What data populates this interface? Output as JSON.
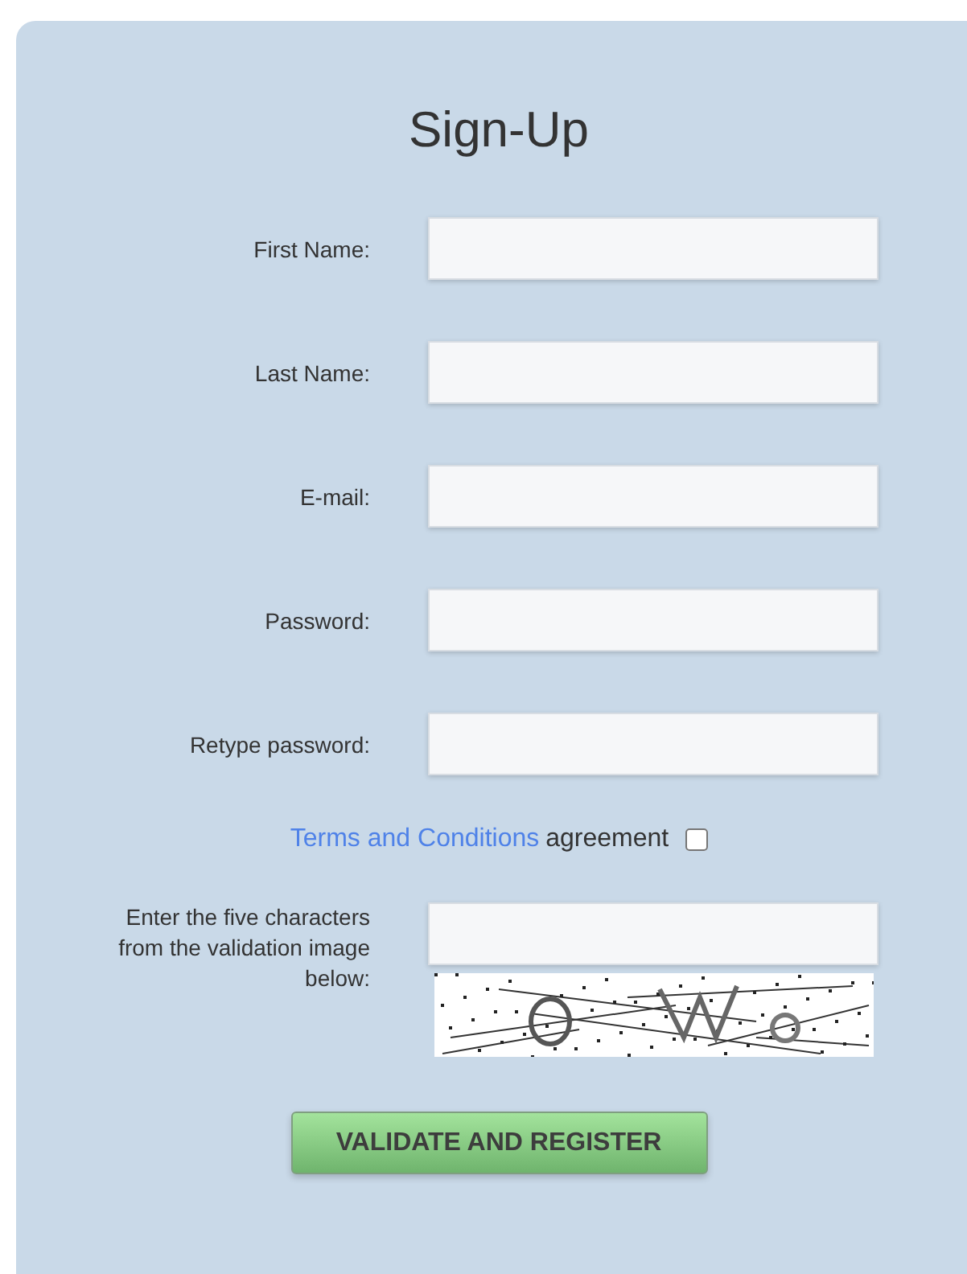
{
  "title": "Sign-Up",
  "fields": [
    {
      "label": "First Name:"
    },
    {
      "label": "Last Name:"
    },
    {
      "label": "E-mail:"
    },
    {
      "label": "Password:"
    },
    {
      "label": "Retype password:"
    }
  ],
  "terms": {
    "link": "Terms and Conditions",
    "text": "agreement",
    "checked": false
  },
  "captcha": {
    "label": "Enter the five characters from the validation image below:"
  },
  "submit": "VALIDATE AND REGISTER"
}
